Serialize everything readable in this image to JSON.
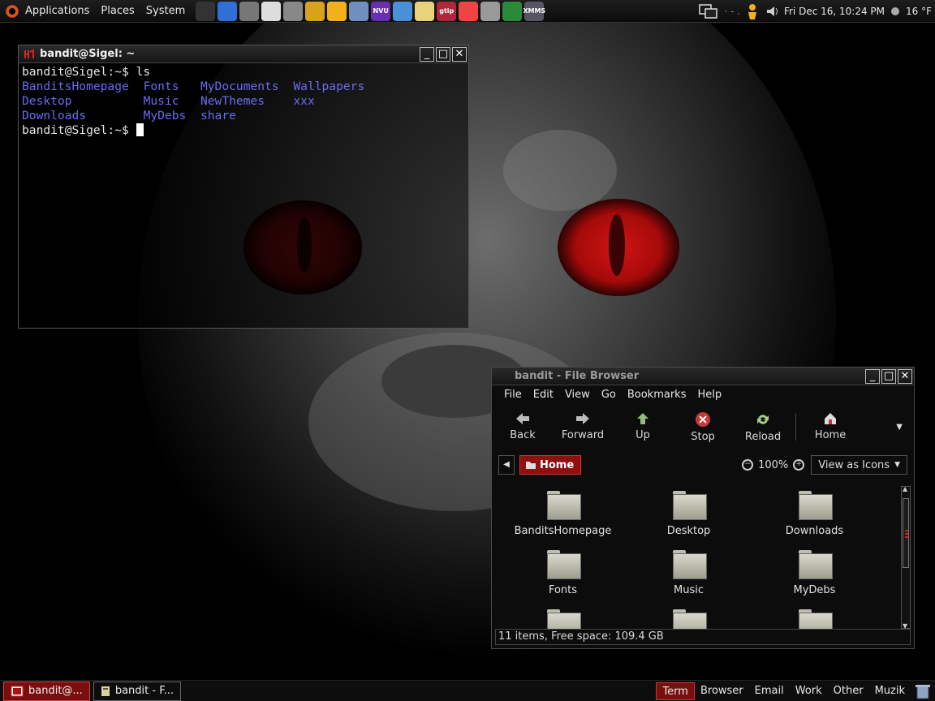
{
  "top_panel": {
    "menus": [
      "Applications",
      "Places",
      "System"
    ],
    "launchers": [
      {
        "icon": "terminal-icon",
        "text": ""
      },
      {
        "icon": "cube-icon",
        "text": ""
      },
      {
        "icon": "calculator-icon",
        "text": ""
      },
      {
        "icon": "text-editor-icon",
        "text": ""
      },
      {
        "icon": "gimp-icon",
        "text": ""
      },
      {
        "icon": "tools-icon",
        "text": ""
      },
      {
        "icon": "person-icon",
        "text": ""
      },
      {
        "icon": "file-manager-icon",
        "text": ""
      },
      {
        "icon": "nvu-icon",
        "text": "NVU"
      },
      {
        "icon": "image-viewer-icon",
        "text": ""
      },
      {
        "icon": "cd-icon",
        "text": ""
      },
      {
        "icon": "gnome-panel-icon",
        "text": "gtip"
      },
      {
        "icon": "disc-burner-icon",
        "text": ""
      },
      {
        "icon": "archive-icon",
        "text": ""
      },
      {
        "icon": "chain-icon",
        "text": ""
      },
      {
        "icon": "xmms-icon",
        "text": "XMMS"
      }
    ],
    "datetime": "Fri Dec 16, 10:24 PM",
    "weather": "16 °F"
  },
  "terminal": {
    "title": "bandit@Sigel: ~",
    "prompt": "bandit@Sigel:~$ ",
    "command": "ls",
    "listing": [
      [
        "BanditsHomepage",
        "Fonts",
        "MyDocuments",
        "Wallpapers"
      ],
      [
        "Desktop",
        "Music",
        "NewThemes",
        "xxx"
      ],
      [
        "Downloads",
        "MyDebs",
        "share",
        ""
      ]
    ]
  },
  "file_browser": {
    "title": "bandit - File Browser",
    "menu": [
      "File",
      "Edit",
      "View",
      "Go",
      "Bookmarks",
      "Help"
    ],
    "toolbar": {
      "back": "Back",
      "forward": "Forward",
      "up": "Up",
      "stop": "Stop",
      "reload": "Reload",
      "home": "Home"
    },
    "location": "Home",
    "zoom": "100%",
    "view_mode": "View as Icons",
    "items": [
      "BanditsHomepage",
      "Desktop",
      "Downloads",
      "Fonts",
      "Music",
      "MyDebs",
      "",
      "",
      ""
    ],
    "status": "11 items, Free space: 109.4 GB",
    "colors": {
      "accent": "#8e1010"
    }
  },
  "bottom_panel": {
    "tasks": [
      {
        "label": "bandit@...",
        "icon": "terminal-icon",
        "active": true
      },
      {
        "label": "bandit - F...",
        "icon": "file-manager-icon",
        "active": false
      }
    ],
    "workspaces": [
      "Term",
      "Browser",
      "Email",
      "Work",
      "Other",
      "Muzik"
    ],
    "active_workspace": "Term"
  }
}
